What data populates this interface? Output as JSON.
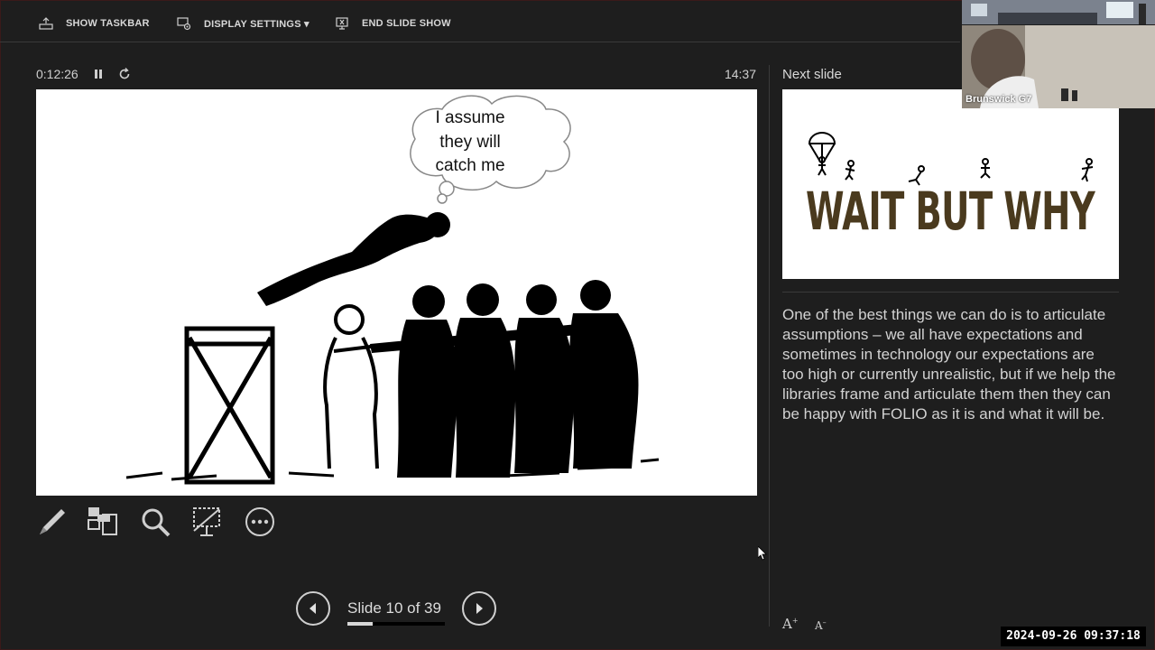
{
  "toolbar": {
    "show_taskbar": "SHOW TASKBAR",
    "display_settings": "DISPLAY SETTINGS ▾",
    "end_slide_show": "END SLIDE SHOW"
  },
  "presenter": {
    "elapsed": "0:12:26",
    "clock": "14:37",
    "slide_counter": "Slide 10 of 39",
    "progress_fraction": 0.256
  },
  "current_slide": {
    "bubble_lines": [
      "I assume",
      "they will",
      "catch me"
    ]
  },
  "next_slide": {
    "label": "Next slide",
    "logo_text": "WAIT BUT WHY"
  },
  "notes": {
    "text": "One of the best things we can do is to articulate assumptions – we all have expectations and sometimes in technology our expectations are too high or currently unrealistic, but if we help the libraries frame and articulate them then they can be happy with FOLIO as it is and what it will be."
  },
  "notes_controls": {
    "increase": "A",
    "decrease": "A"
  },
  "video": {
    "participant": "Brunswick G7"
  },
  "recording_timestamp": "2024-09-26 09:37:18",
  "icons": [
    "taskbar-icon",
    "display-settings-icon",
    "end-show-icon",
    "pause-icon",
    "reset-icon",
    "pen-icon",
    "all-slides-icon",
    "zoom-icon",
    "black-screen-icon",
    "more-options-icon",
    "prev-arrow-icon",
    "next-arrow-icon"
  ],
  "colors": {
    "background": "#1e1e1e",
    "text": "#e6e6e6",
    "logo_brown": "#4a3a1e"
  }
}
